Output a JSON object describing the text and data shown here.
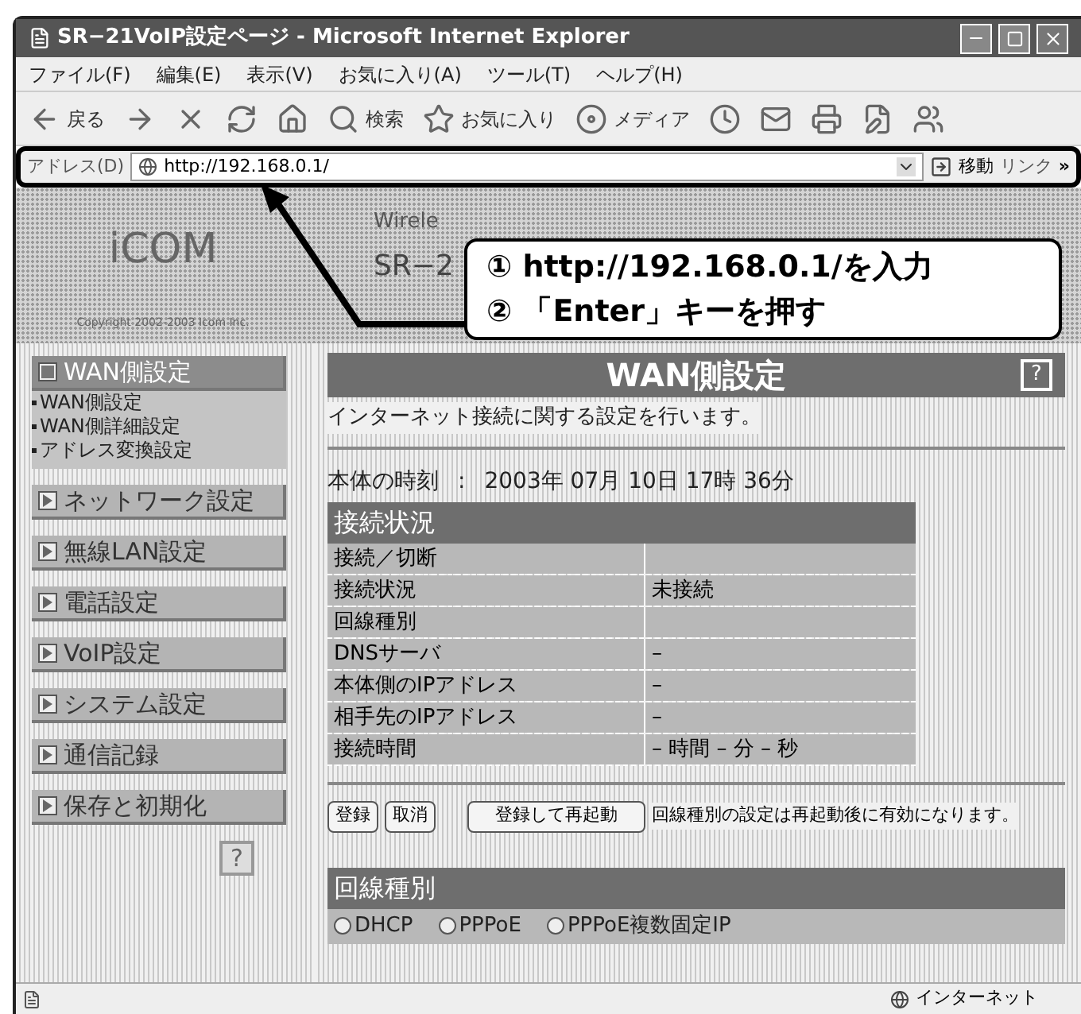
{
  "window": {
    "title": "SR−21VoIP設定ページ - Microsoft Internet Explorer"
  },
  "menu": [
    "ファイル(F)",
    "編集(E)",
    "表示(V)",
    "お気に入り(A)",
    "ツール(T)",
    "ヘルプ(H)"
  ],
  "toolbar": [
    {
      "kind": "back",
      "label": "戻る"
    },
    {
      "kind": "forward"
    },
    {
      "kind": "stop"
    },
    {
      "kind": "refresh"
    },
    {
      "kind": "home"
    },
    {
      "kind": "search",
      "label": "検索"
    },
    {
      "kind": "favorites",
      "label": "お気に入り"
    },
    {
      "kind": "media",
      "label": "メディア"
    },
    {
      "kind": "history"
    },
    {
      "kind": "mail"
    },
    {
      "kind": "print"
    },
    {
      "kind": "edit"
    },
    {
      "kind": "messenger"
    }
  ],
  "address_bar": {
    "label": "アドレス(D)",
    "value": "http://192.168.0.1/",
    "go": "移動",
    "links": "リンク",
    "more": "»"
  },
  "header": {
    "logo": "iCOM",
    "copyright": "Copyright 2002-2003 Icom Inc.",
    "subtitle": "Wirele",
    "model": "SR−2"
  },
  "callout": [
    "① http://192.168.0.1/を入力",
    "② 「Enter」キーを押す"
  ],
  "sidebar": {
    "items": [
      {
        "label": "WAN側設定",
        "expanded": true,
        "children": [
          "WAN側設定",
          "WAN側詳細設定",
          "アドレス変換設定"
        ]
      },
      {
        "label": "ネットワーク設定",
        "expanded": false
      },
      {
        "label": "無線LAN設定",
        "expanded": false
      },
      {
        "label": "電話設定",
        "expanded": false
      },
      {
        "label": "VoIP設定",
        "expanded": false
      },
      {
        "label": "システム設定",
        "expanded": false
      },
      {
        "label": "通信記録",
        "expanded": false
      },
      {
        "label": "保存と初期化",
        "expanded": false
      }
    ],
    "help": "?"
  },
  "page": {
    "heading": "WAN側設定",
    "help": "?",
    "description": "インターネット接続に関する設定を行います。",
    "clock": {
      "label": "本体の時刻",
      "separator": ":",
      "value": "2003年 07月 10日 17時 36分"
    },
    "status_table": {
      "title": "接続状況",
      "rows": [
        {
          "label": "接続／切断"
        },
        {
          "label": "接続状況",
          "value": "未接続"
        },
        {
          "label": "回線種別"
        },
        {
          "label": "DNSサーバ",
          "value": "–"
        },
        {
          "label": "本体側のIPアドレス",
          "value": "–"
        },
        {
          "label": "相手先のIPアドレス",
          "value": "–"
        },
        {
          "label": "接続時間",
          "value": "– 時間 – 分 – 秒"
        }
      ]
    },
    "buttons": [
      "登録",
      "取消",
      "登録して再起動"
    ],
    "note": "回線種別の設定は再起動後に有効になります。",
    "line_type": {
      "title": "回線種別",
      "options": [
        {
          "label": "DHCP",
          "selected": false
        },
        {
          "label": "PPPoE",
          "selected": false
        },
        {
          "label": "PPPoE複数固定IP",
          "selected": false
        }
      ]
    }
  },
  "status_bar": {
    "zone": "インターネット"
  }
}
